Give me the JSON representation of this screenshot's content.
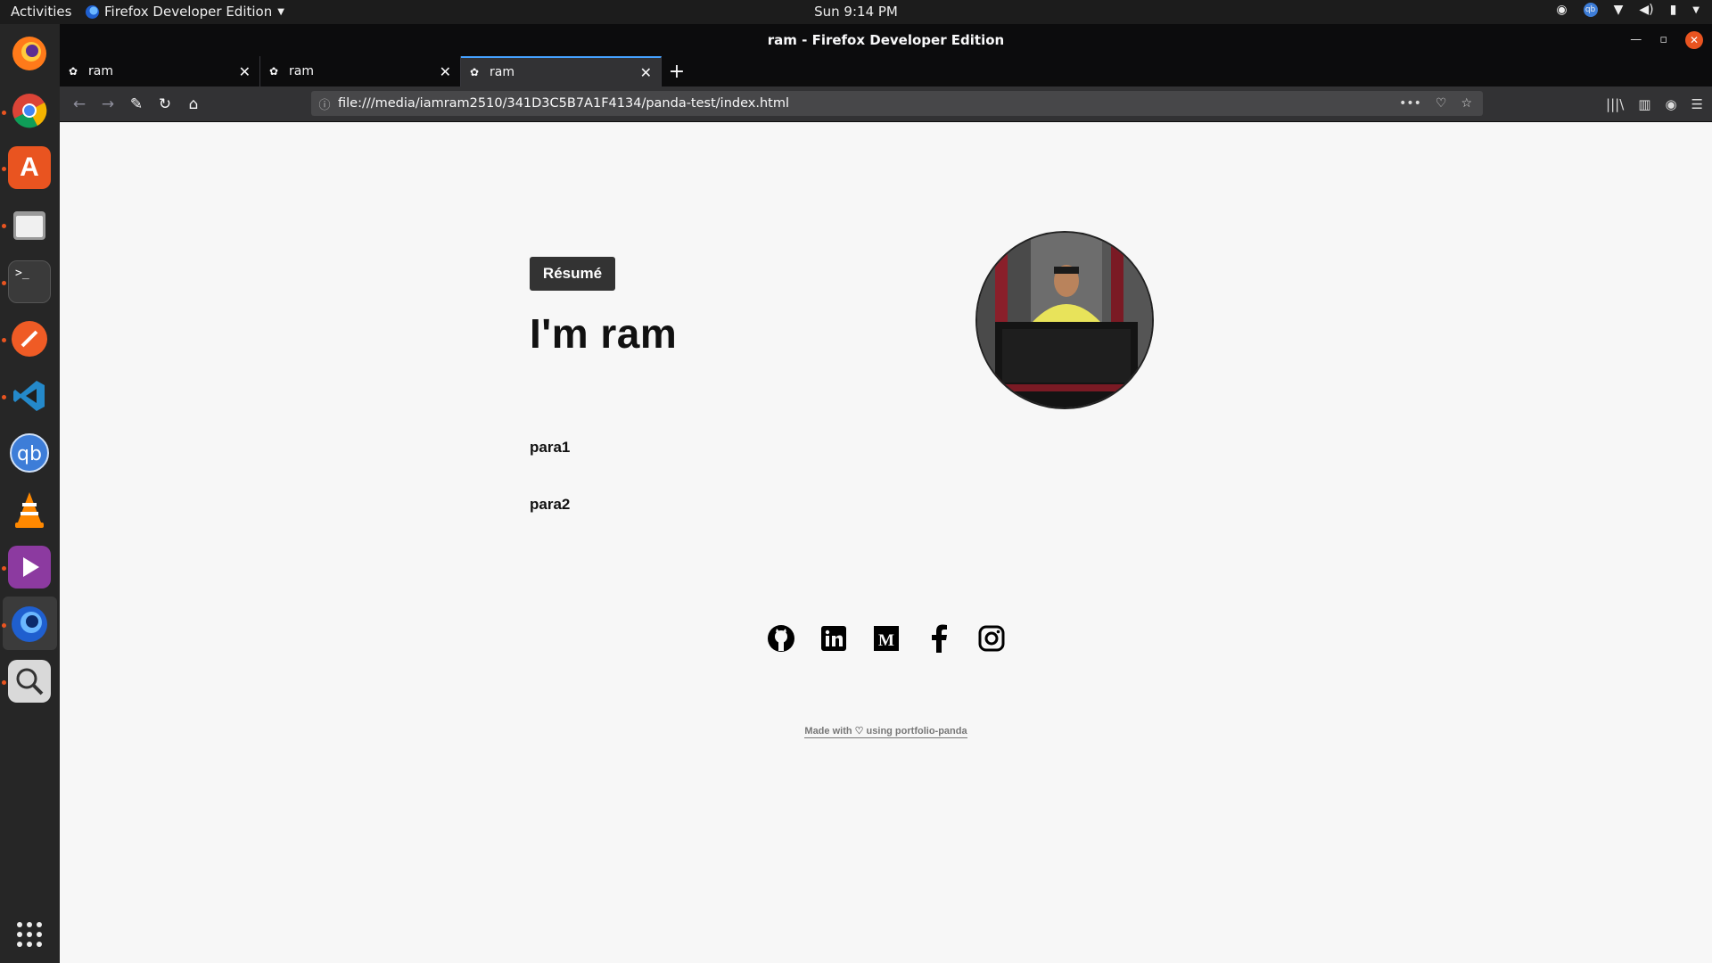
{
  "topbar": {
    "activities": "Activities",
    "app_name": "Firefox Developer Edition",
    "clock": "Sun  9:14 PM"
  },
  "window": {
    "title": "ram - Firefox Developer Edition"
  },
  "tabs": [
    {
      "label": "ram",
      "active": false
    },
    {
      "label": "ram",
      "active": false
    },
    {
      "label": "ram",
      "active": true
    }
  ],
  "urlbar": {
    "url": "file:///media/iamram2510/341D3C5B7A1F4134/panda-test/index.html"
  },
  "dock": {
    "apps": [
      "firefox-icon",
      "chrome-icon",
      "software-center-icon",
      "files-icon",
      "terminal-icon",
      "postman-icon",
      "vscode-icon",
      "qbittorrent-icon",
      "vlc-icon",
      "video-player-icon",
      "firefox-developer-icon",
      "image-viewer-icon",
      "show-apps-icon"
    ]
  },
  "page": {
    "resume_button": "Résumé",
    "headline": "I'm ram",
    "para1": "para1",
    "para2": "para2",
    "socials": [
      "github-icon",
      "linkedin-icon",
      "medium-icon",
      "facebook-icon",
      "instagram-icon"
    ],
    "footer_prefix": "Made with ♡ using portfolio-panda"
  },
  "colors": {
    "accent": "#e95420",
    "tab_highlight": "#45a1ff",
    "page_bg": "#f7f7f7",
    "button_bg": "#333333"
  }
}
